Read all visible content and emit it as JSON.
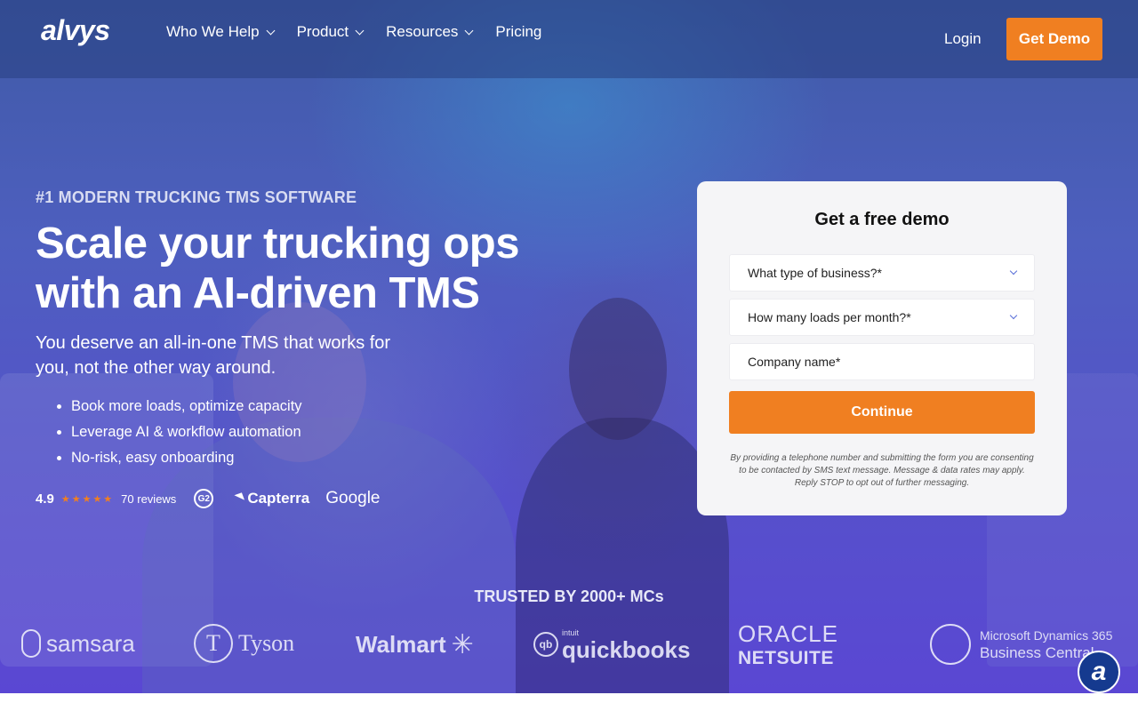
{
  "header": {
    "logo": "alvys",
    "nav": [
      {
        "label": "Who We Help",
        "dropdown": true
      },
      {
        "label": "Product",
        "dropdown": true
      },
      {
        "label": "Resources",
        "dropdown": true
      },
      {
        "label": "Pricing",
        "dropdown": false
      }
    ],
    "login_label": "Login",
    "cta_label": "Get Demo"
  },
  "hero": {
    "eyebrow": "#1 MODERN TRUCKING TMS SOFTWARE",
    "headline": "Scale your trucking ops with an AI-driven TMS",
    "subhead": "You deserve an all-in-one TMS that works for you, not the other way around.",
    "bullets": [
      "Book more loads, optimize capacity",
      "Leverage AI & workflow automation",
      "No-risk, easy onboarding"
    ],
    "rating": {
      "value": "4.9",
      "stars": 5,
      "stars_glyphs": "★★★★★",
      "reviews": "70 reviews",
      "badges": [
        "G2",
        "Capterra",
        "Google"
      ]
    }
  },
  "demo_form": {
    "title": "Get a free demo",
    "fields": [
      {
        "placeholder": "What type of business?*",
        "type": "select"
      },
      {
        "placeholder": "How many loads per month?*",
        "type": "select"
      },
      {
        "placeholder": "Company name*",
        "type": "text"
      }
    ],
    "submit_label": "Continue",
    "disclaimer": "By providing a telephone number and submitting the form you are consenting to be contacted by SMS text message. Message & data rates may apply. Reply STOP to opt out of further messaging."
  },
  "trusted": {
    "heading": "TRUSTED BY 2000+ MCs",
    "logos": {
      "samsara": "samsara",
      "tyson": "Tyson",
      "walmart": "Walmart",
      "quickbooks_small": "intuit",
      "quickbooks": "quickbooks",
      "oracle": "ORACLE",
      "netsuite": "NETSUITE",
      "ms_line1": "Microsoft Dynamics 365",
      "ms_line2": "Business Central"
    }
  },
  "chat": {
    "icon": "chat-launcher-icon",
    "glyph": "a"
  },
  "colors": {
    "accent": "#f07f21",
    "header": "#2f4a8c",
    "hero": "#5651cb",
    "card": "#f5f5f7"
  }
}
